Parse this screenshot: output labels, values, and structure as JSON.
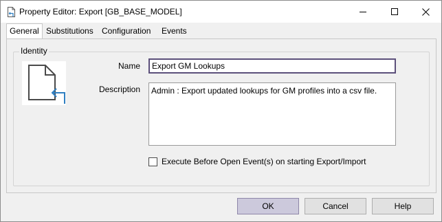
{
  "window": {
    "title": "Property Editor: Export [GB_BASE_MODEL]",
    "controls": [
      "minimize-icon",
      "maximize-icon",
      "close-icon"
    ]
  },
  "tabs": [
    {
      "label": "General",
      "active": true
    },
    {
      "label": "Substitutions",
      "active": false
    },
    {
      "label": "Configuration",
      "active": false
    },
    {
      "label": "Events",
      "active": false
    }
  ],
  "identity": {
    "group_title": "Identity",
    "icon": "export-document-icon",
    "name_label": "Name",
    "name_value": "Export GM Lookups",
    "description_label": "Description",
    "description_value": "Admin : Export updated lookups for GM profiles into a csv file.",
    "execute_checkbox_label": "Execute Before Open Event(s) on starting Export/Import",
    "execute_checked": false
  },
  "buttons": {
    "ok": "OK",
    "cancel": "Cancel",
    "help": "Help"
  },
  "colors": {
    "accent_blue": "#2f7fc1",
    "default_button": "#ccc9dc",
    "focus_border": "#5b4f7a"
  }
}
